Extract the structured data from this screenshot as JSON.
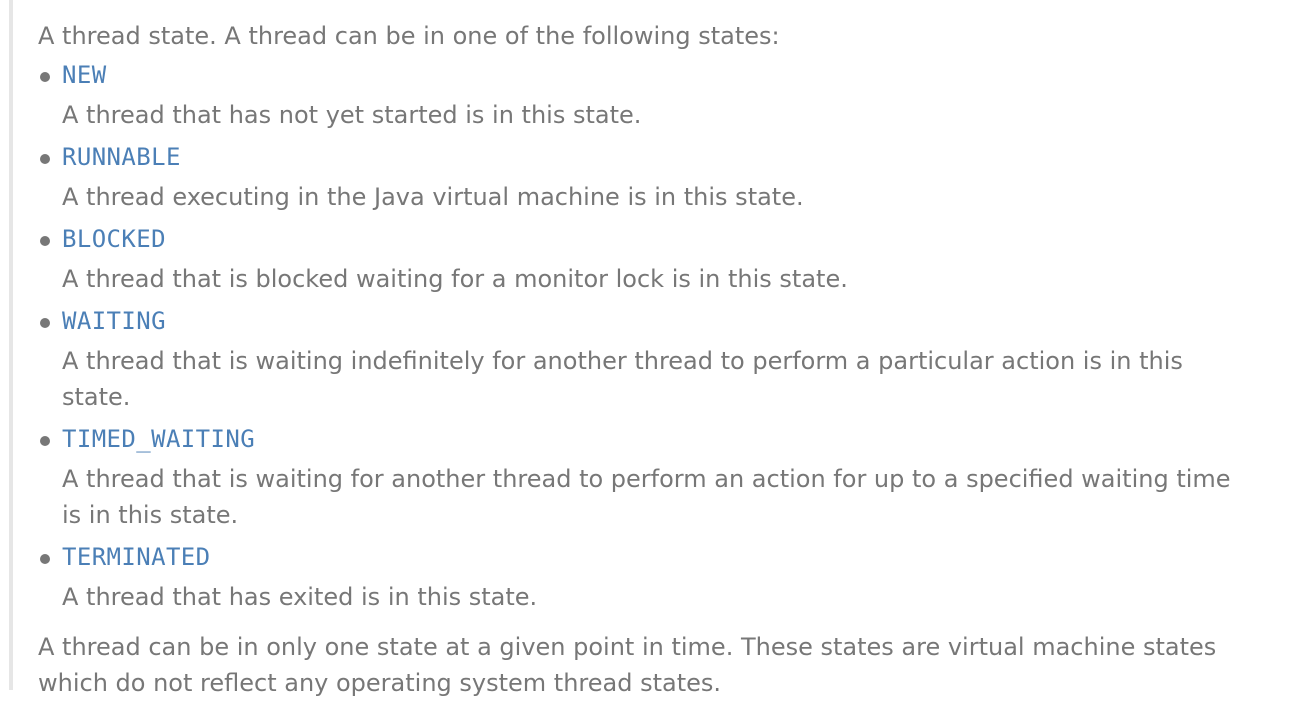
{
  "doc": {
    "intro": "A thread state. A thread can be in one of the following states:",
    "states": [
      {
        "name": "NEW",
        "description": "A thread that has not yet started is in this state."
      },
      {
        "name": "RUNNABLE",
        "description": "A thread executing in the Java virtual machine is in this state."
      },
      {
        "name": "BLOCKED",
        "description": "A thread that is blocked waiting for a monitor lock is in this state."
      },
      {
        "name": "WAITING",
        "description": "A thread that is waiting indefinitely for another thread to perform a particular action is in this state."
      },
      {
        "name": "TIMED_WAITING",
        "description": "A thread that is waiting for another thread to perform an action for up to a specified waiting time is in this state."
      },
      {
        "name": "TERMINATED",
        "description": "A thread that has exited is in this state."
      }
    ],
    "outro": "A thread can be in only one state at a given point in time. These states are virtual machine states which do not reflect any operating system thread states."
  }
}
